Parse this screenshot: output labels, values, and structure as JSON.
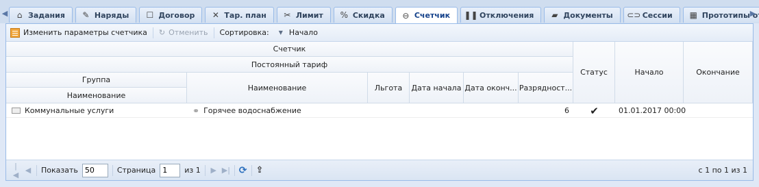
{
  "tabs": [
    {
      "label": "Задания",
      "icon": "task-icon"
    },
    {
      "label": "Наряды",
      "icon": "wrench-icon"
    },
    {
      "label": "Договор",
      "icon": "contract-icon"
    },
    {
      "label": "Тар. план",
      "icon": "tariff-icon"
    },
    {
      "label": "Лимит",
      "icon": "scissors-icon"
    },
    {
      "label": "Скидка",
      "icon": "discount-icon"
    },
    {
      "label": "Счетчик",
      "icon": "meter-icon"
    },
    {
      "label": "Отключения",
      "icon": "pause-icon"
    },
    {
      "label": "Документы",
      "icon": "documents-icon"
    },
    {
      "label": "Сессии",
      "icon": "sessions-icon"
    },
    {
      "label": "Прототипы отчетов",
      "icon": "report-icon"
    }
  ],
  "toolbar": {
    "edit_label": "Изменить параметры счетчика",
    "cancel_label": "Отменить",
    "sort_label": "Сортировка:",
    "sort_value": "Начало"
  },
  "grid": {
    "headers": {
      "meter": "Счетчик",
      "fixed_tariff": "Постоянный тариф",
      "group": "Группа",
      "group_name": "Наименование",
      "name": "Наименование",
      "benefit": "Льгота",
      "start_date": "Дата начала",
      "end_date": "Дата оконч...",
      "digits": "Разрядност...",
      "status": "Статус",
      "start": "Начало",
      "end": "Окончание"
    },
    "rows": [
      {
        "group_name": "Коммунальные услуги",
        "name": "Горячее водоснабжение",
        "benefit": "",
        "start_date": "",
        "end_date": "",
        "digits": "6",
        "status": "✔",
        "start": "01.01.2017 00:00",
        "end": ""
      }
    ]
  },
  "pager": {
    "show_label": "Показать",
    "page_size": "50",
    "page_label": "Страница",
    "page_value": "1",
    "of_label": "из 1",
    "info": "с 1 по 1 из 1"
  },
  "colors": {
    "accent": "#15428b",
    "tab_border": "#99bbe8",
    "background": "#dfe8f6"
  }
}
